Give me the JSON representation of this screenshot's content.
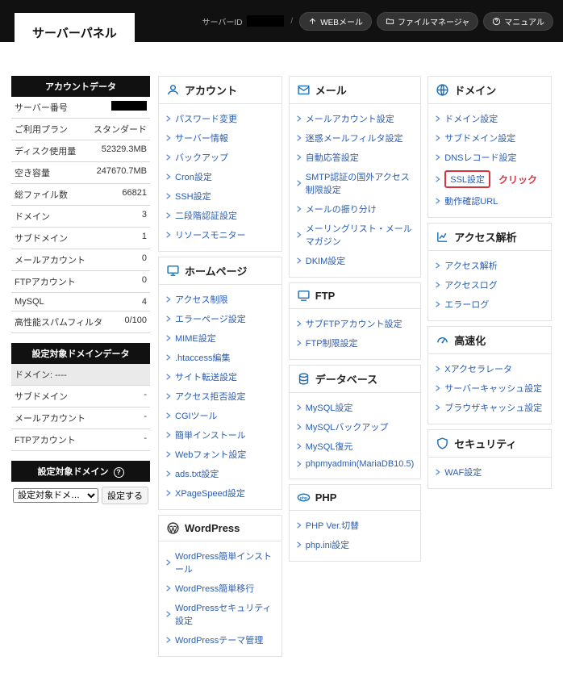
{
  "header": {
    "panel_title": "サーバーパネル",
    "server_id_label": "サーバーID",
    "webmail": "WEBメール",
    "filemanager": "ファイルマネージャ",
    "manual": "マニュアル"
  },
  "sidebar": {
    "account_head": "アカウントデータ",
    "rows": [
      {
        "label": "サーバー番号",
        "value": ""
      },
      {
        "label": "ご利用プラン",
        "value": "スタンダード"
      },
      {
        "label": "ディスク使用量",
        "value": "52329.3MB"
      },
      {
        "label": "空き容量",
        "value": "247670.7MB"
      },
      {
        "label": "総ファイル数",
        "value": "66821"
      },
      {
        "label": "ドメイン",
        "value": "3"
      },
      {
        "label": "サブドメイン",
        "value": "1"
      },
      {
        "label": "メールアカウント",
        "value": "0"
      },
      {
        "label": "FTPアカウント",
        "value": "0"
      },
      {
        "label": "MySQL",
        "value": "4"
      },
      {
        "label": "高性能スパムフィルタ",
        "value": "0/100"
      }
    ],
    "target_head": "設定対象ドメインデータ",
    "target_rows": [
      {
        "label": "ドメイン: ----",
        "value": ""
      },
      {
        "label": "サブドメイン",
        "value": "-"
      },
      {
        "label": "メールアカウント",
        "value": "-"
      },
      {
        "label": "FTPアカウント",
        "value": "-"
      }
    ],
    "select_head": "設定対象ドメイン",
    "select_value": "設定対象ドメイン",
    "select_btn": "設定する"
  },
  "columns": [
    [
      {
        "title": "アカウント",
        "icon": "user",
        "items": [
          "パスワード変更",
          "サーバー情報",
          "バックアップ",
          "Cron設定",
          "SSH設定",
          "二段階認証設定",
          "リソースモニター"
        ]
      },
      {
        "title": "ホームページ",
        "icon": "monitor",
        "items": [
          "アクセス制限",
          "エラーページ設定",
          "MIME設定",
          ".htaccess編集",
          "サイト転送設定",
          "アクセス拒否設定",
          "CGIツール",
          "簡単インストール",
          "Webフォント設定",
          "ads.txt設定",
          "XPageSpeed設定"
        ]
      },
      {
        "title": "WordPress",
        "icon": "wp",
        "items": [
          "WordPress簡単インストール",
          "WordPress簡単移行",
          "WordPressセキュリティ設定",
          "WordPressテーマ管理"
        ]
      }
    ],
    [
      {
        "title": "メール",
        "icon": "mail",
        "items": [
          "メールアカウント設定",
          "迷惑メールフィルタ設定",
          "自動応答設定",
          "SMTP認証の国外アクセス制限設定",
          "メールの振り分け",
          "メーリングリスト・メールマガジン",
          "DKIM設定"
        ]
      },
      {
        "title": "FTP",
        "icon": "ftp",
        "items": [
          "サブFTPアカウント設定",
          "FTP制限設定"
        ]
      },
      {
        "title": "データベース",
        "icon": "db",
        "items": [
          "MySQL設定",
          "MySQLバックアップ",
          "MySQL復元",
          "phpmyadmin(MariaDB10.5)"
        ]
      },
      {
        "title": "PHP",
        "icon": "php",
        "items": [
          "PHP Ver.切替",
          "php.ini設定"
        ]
      }
    ],
    [
      {
        "title": "ドメイン",
        "icon": "globe",
        "items": [
          "ドメイン設定",
          "サブドメイン設定",
          "DNSレコード設定",
          "SSL設定",
          "動作確認URL"
        ],
        "highlight_index": 3,
        "click_note": "クリック"
      },
      {
        "title": "アクセス解析",
        "icon": "chart",
        "items": [
          "アクセス解析",
          "アクセスログ",
          "エラーログ"
        ]
      },
      {
        "title": "高速化",
        "icon": "speed",
        "items": [
          "Xアクセラレータ",
          "サーバーキャッシュ設定",
          "ブラウザキャッシュ設定"
        ]
      },
      {
        "title": "セキュリティ",
        "icon": "shield",
        "items": [
          "WAF設定"
        ]
      }
    ]
  ]
}
